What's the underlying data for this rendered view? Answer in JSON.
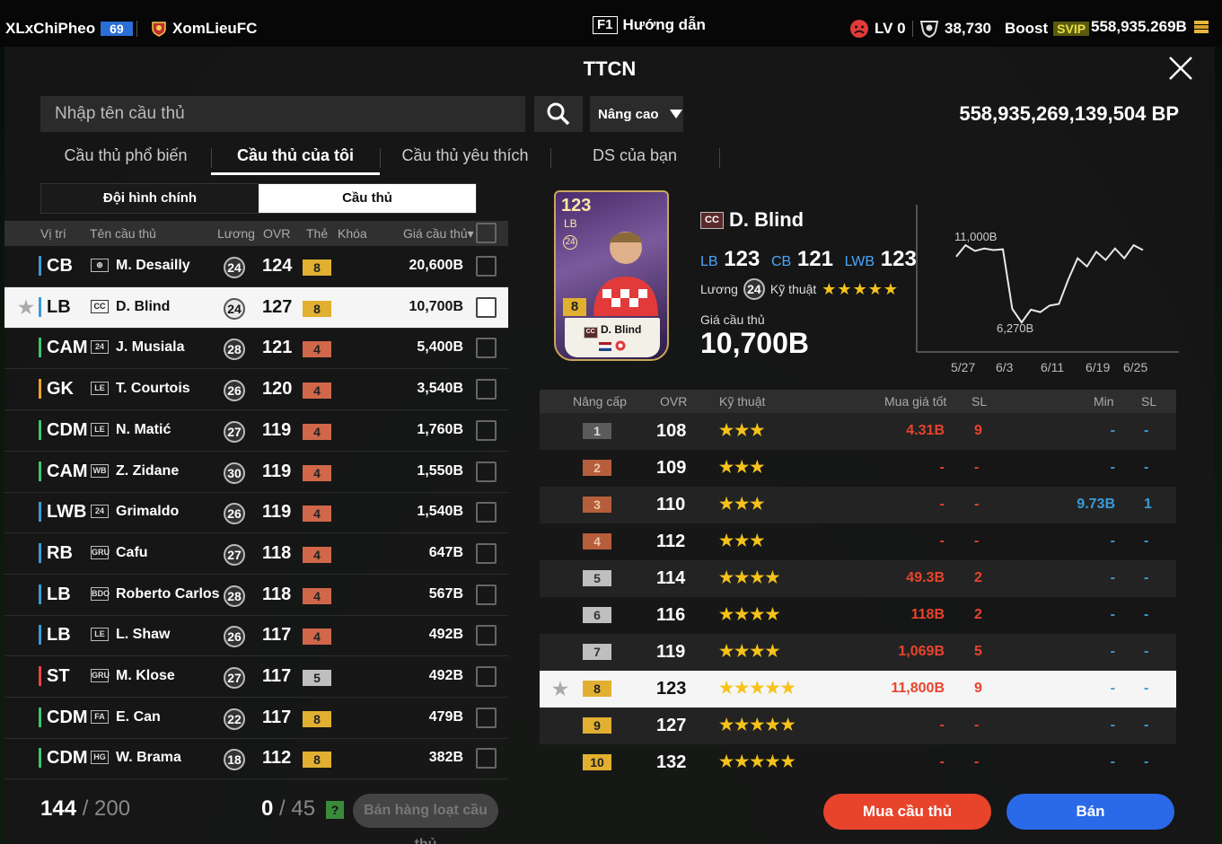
{
  "topbar": {
    "username": "XLxChiPheo",
    "user_level": "69",
    "club": "XomLieuFC",
    "help_key": "F1",
    "help_label": "Hướng dẫn",
    "lv_label": "LV 0",
    "tokens": "38,730",
    "boost_label": "Boost",
    "svip_label": "SVIP",
    "balance": "558,935.269B"
  },
  "window": {
    "title": "TTCN"
  },
  "search": {
    "placeholder": "Nhập tên cầu thủ",
    "advanced_label": "Nâng cao",
    "bp_balance": "558,935,269,139,504",
    "bp_unit": "BP"
  },
  "tabs": [
    "Cầu thủ phổ biến",
    "Cầu thủ của tôi",
    "Cầu thủ yêu thích",
    "DS của bạn"
  ],
  "segment": {
    "left": "Đội hình chính",
    "right": "Cầu thủ"
  },
  "list_header": {
    "pos": "Vị trí",
    "name": "Tên cầu thủ",
    "wage": "Lương",
    "ovr": "OVR",
    "card": "Thẻ",
    "lock": "Khóa",
    "price": "Giá cầu thủ▾"
  },
  "players": [
    {
      "pos": "CB",
      "pos_group": "def",
      "season": "⊕",
      "name": "M. Desailly",
      "wage": "24",
      "ovr": "124",
      "level": "8",
      "level_color": "gold",
      "price": "20,600B",
      "starred": ""
    },
    {
      "pos": "LB",
      "pos_group": "def",
      "season": "CC",
      "name": "D. Blind",
      "wage": "24",
      "ovr": "127",
      "level": "8",
      "level_color": "gold",
      "price": "10,700B",
      "starred": "★"
    },
    {
      "pos": "CAM",
      "pos_group": "mid",
      "season": "24",
      "name": "J. Musiala",
      "wage": "28",
      "ovr": "121",
      "level": "4",
      "level_color": "orange",
      "price": "5,400B",
      "starred": ""
    },
    {
      "pos": "GK",
      "pos_group": "gk",
      "season": "LE",
      "name": "T. Courtois",
      "wage": "26",
      "ovr": "120",
      "level": "4",
      "level_color": "orange",
      "price": "3,540B",
      "starred": ""
    },
    {
      "pos": "CDM",
      "pos_group": "mid",
      "season": "LE",
      "name": "N. Matić",
      "wage": "27",
      "ovr": "119",
      "level": "4",
      "level_color": "orange",
      "price": "1,760B",
      "starred": ""
    },
    {
      "pos": "CAM",
      "pos_group": "mid",
      "season": "WB",
      "name": "Z. Zidane",
      "wage": "30",
      "ovr": "119",
      "level": "4",
      "level_color": "orange",
      "price": "1,550B",
      "starred": ""
    },
    {
      "pos": "LWB",
      "pos_group": "def",
      "season": "24",
      "name": "Grimaldo",
      "wage": "26",
      "ovr": "119",
      "level": "4",
      "level_color": "orange",
      "price": "1,540B",
      "starred": ""
    },
    {
      "pos": "RB",
      "pos_group": "def",
      "season": "GRU",
      "name": "Cafu",
      "wage": "27",
      "ovr": "118",
      "level": "4",
      "level_color": "orange",
      "price": "647B",
      "starred": ""
    },
    {
      "pos": "LB",
      "pos_group": "def",
      "season": "BDO",
      "name": "Roberto Carlos",
      "wage": "28",
      "ovr": "118",
      "level": "4",
      "level_color": "orange",
      "price": "567B",
      "starred": ""
    },
    {
      "pos": "LB",
      "pos_group": "def",
      "season": "LE",
      "name": "L. Shaw",
      "wage": "26",
      "ovr": "117",
      "level": "4",
      "level_color": "orange",
      "price": "492B",
      "starred": ""
    },
    {
      "pos": "ST",
      "pos_group": "attack",
      "season": "GRU",
      "name": "M. Klose",
      "wage": "27",
      "ovr": "117",
      "level": "5",
      "level_color": "gray",
      "price": "492B",
      "starred": ""
    },
    {
      "pos": "CDM",
      "pos_group": "mid",
      "season": "FA",
      "name": "E. Can",
      "wage": "22",
      "ovr": "117",
      "level": "8",
      "level_color": "gold",
      "price": "479B",
      "starred": ""
    },
    {
      "pos": "CDM",
      "pos_group": "mid",
      "season": "HG",
      "name": "W. Brama",
      "wage": "18",
      "ovr": "112",
      "level": "8",
      "level_color": "gold",
      "price": "382B",
      "starred": ""
    }
  ],
  "footer": {
    "count": "144",
    "capacity": "/ 200",
    "selected": "0",
    "selected_cap": "/ 45",
    "help": "?",
    "bulk_sell": "Bán hàng loạt cầu thủ"
  },
  "detail": {
    "card_ovr": "123",
    "card_pos": "LB",
    "card_badge": "24",
    "card_level": "8",
    "season": "CC",
    "name": "D. Blind",
    "positions": [
      {
        "pos": "LB",
        "ovr": "123"
      },
      {
        "pos": "CB",
        "ovr": "121"
      },
      {
        "pos": "LWB",
        "ovr": "123"
      }
    ],
    "wage_label": "Lương",
    "wage": "24",
    "skill_label": "Kỹ thuật",
    "skill_stars": "★★★★★",
    "price_label": "Giá cầu thủ",
    "price": "10,700B"
  },
  "chart_data": {
    "type": "line",
    "x": [
      "5/27",
      "6/3",
      "6/11",
      "6/19",
      "6/25"
    ],
    "annotations": {
      "max": "11,000B",
      "min": "6,270B"
    },
    "values": [
      10300,
      11000,
      10650,
      10800,
      10700,
      10750,
      7100,
      6270,
      7050,
      6900,
      7300,
      7400,
      8900,
      10200,
      9700,
      10600,
      10100,
      10800,
      10200,
      11000,
      10700
    ],
    "ylim": [
      6000,
      11500
    ]
  },
  "upgrade_header": {
    "level": "Nâng cấp",
    "ovr": "OVR",
    "skill": "Kỹ thuật",
    "best_buy": "Mua giá tốt",
    "sl": "SL",
    "min": "Min",
    "sl2": "SL"
  },
  "upgrades": [
    {
      "level": "1",
      "color": "silver",
      "ovr": "108",
      "stars": "★★★",
      "buy": "4.31B",
      "sl": "9",
      "min": "-",
      "sl2": "-",
      "starred": ""
    },
    {
      "level": "2",
      "color": "bronze",
      "ovr": "109",
      "stars": "★★★",
      "buy": "-",
      "sl": "-",
      "min": "-",
      "sl2": "-",
      "starred": ""
    },
    {
      "level": "3",
      "color": "bronze",
      "ovr": "110",
      "stars": "★★★",
      "buy": "-",
      "sl": "-",
      "min": "9.73B",
      "sl2": "1",
      "starred": ""
    },
    {
      "level": "4",
      "color": "bronze",
      "ovr": "112",
      "stars": "★★★",
      "buy": "-",
      "sl": "-",
      "min": "-",
      "sl2": "-",
      "starred": ""
    },
    {
      "level": "5",
      "color": "gray",
      "ovr": "114",
      "stars": "★★★★",
      "buy": "49.3B",
      "sl": "2",
      "min": "-",
      "sl2": "-",
      "starred": ""
    },
    {
      "level": "6",
      "color": "gray",
      "ovr": "116",
      "stars": "★★★★",
      "buy": "118B",
      "sl": "2",
      "min": "-",
      "sl2": "-",
      "starred": ""
    },
    {
      "level": "7",
      "color": "gray",
      "ovr": "119",
      "stars": "★★★★",
      "buy": "1,069B",
      "sl": "5",
      "min": "-",
      "sl2": "-",
      "starred": ""
    },
    {
      "level": "8",
      "color": "gold",
      "ovr": "123",
      "stars": "★★★★★",
      "buy": "11,800B",
      "sl": "9",
      "min": "-",
      "sl2": "-",
      "starred": "★"
    },
    {
      "level": "9",
      "color": "gold",
      "ovr": "127",
      "stars": "★★★★★",
      "buy": "-",
      "sl": "-",
      "min": "-",
      "sl2": "-",
      "starred": ""
    },
    {
      "level": "10",
      "color": "gold",
      "ovr": "132",
      "stars": "★★★★★",
      "buy": "-",
      "sl": "-",
      "min": "-",
      "sl2": "-",
      "starred": ""
    }
  ],
  "actions": {
    "buy": "Mua cầu thủ",
    "sell": "Bán"
  }
}
